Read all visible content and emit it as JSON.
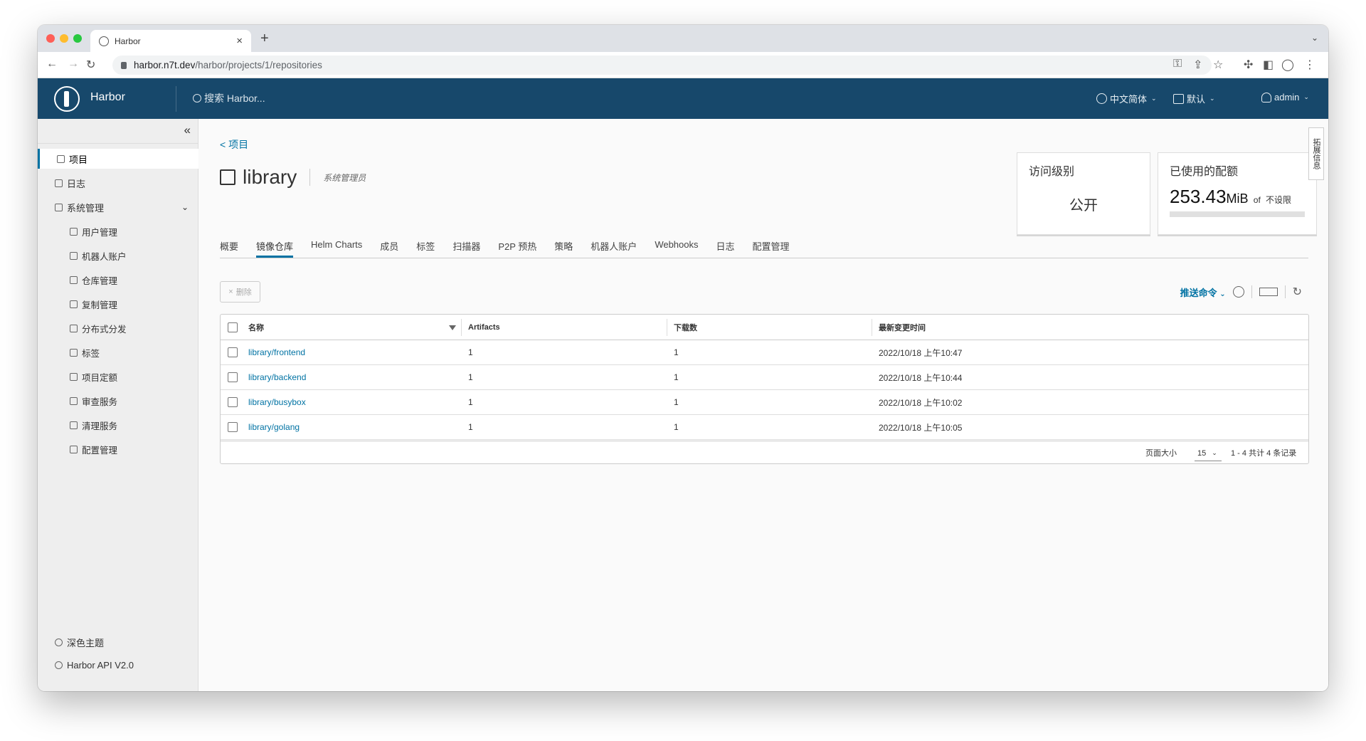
{
  "browser": {
    "tab_title": "Harbor",
    "url_host": "harbor.n7t.dev",
    "url_path": "/harbor/projects/1/repositories"
  },
  "header": {
    "brand": "Harbor",
    "search_placeholder": "搜索 Harbor...",
    "language": "中文简体",
    "datetime_format": "默认",
    "user": "admin"
  },
  "sidebar": {
    "items": [
      {
        "label": "项目",
        "icon": "projects-icon",
        "active": true
      },
      {
        "label": "日志",
        "icon": "logs-icon"
      },
      {
        "label": "系统管理",
        "icon": "admin-icon"
      }
    ],
    "subitems": [
      {
        "label": "用户管理",
        "icon": "users-icon"
      },
      {
        "label": "机器人账户",
        "icon": "robot-icon"
      },
      {
        "label": "仓库管理",
        "icon": "registry-icon"
      },
      {
        "label": "复制管理",
        "icon": "replication-icon"
      },
      {
        "label": "分布式分发",
        "icon": "share-icon"
      },
      {
        "label": "标签",
        "icon": "tag-icon"
      },
      {
        "label": "项目定额",
        "icon": "quota-icon"
      },
      {
        "label": "审查服务",
        "icon": "shield-icon"
      },
      {
        "label": "清理服务",
        "icon": "trash-icon"
      },
      {
        "label": "配置管理",
        "icon": "gear-icon"
      }
    ],
    "dark_theme": "深色主题",
    "api": "Harbor API V2.0"
  },
  "project": {
    "back_label": "< 项目",
    "name": "library",
    "role": "系统管理员",
    "access_label": "访问级别",
    "access_value": "公开",
    "quota_label": "已使用的配额",
    "quota_used": "253.43",
    "quota_unit": "MiB",
    "quota_of": "of",
    "quota_limit": "不设限",
    "side_tab": "拓展信息"
  },
  "tabs": [
    "概要",
    "镜像仓库",
    "Helm Charts",
    "成员",
    "标签",
    "扫描器",
    "P2P 预热",
    "策略",
    "机器人账户",
    "Webhooks",
    "日志",
    "配置管理"
  ],
  "toolbar": {
    "delete_label": "删除",
    "push_label": "推送命令"
  },
  "table": {
    "headers": [
      "名称",
      "Artifacts",
      "下载数",
      "最新变更时间"
    ],
    "rows": [
      {
        "name": "library/frontend",
        "artifacts": "1",
        "pulls": "1",
        "time": "2022/10/18 上午10:47"
      },
      {
        "name": "library/backend",
        "artifacts": "1",
        "pulls": "1",
        "time": "2022/10/18 上午10:44"
      },
      {
        "name": "library/busybox",
        "artifacts": "1",
        "pulls": "1",
        "time": "2022/10/18 上午10:02"
      },
      {
        "name": "library/golang",
        "artifacts": "1",
        "pulls": "1",
        "time": "2022/10/18 上午10:05"
      }
    ],
    "footer": {
      "page_size_label": "页面大小",
      "page_size": "15",
      "summary": "1 - 4 共计 4 条记录"
    }
  }
}
